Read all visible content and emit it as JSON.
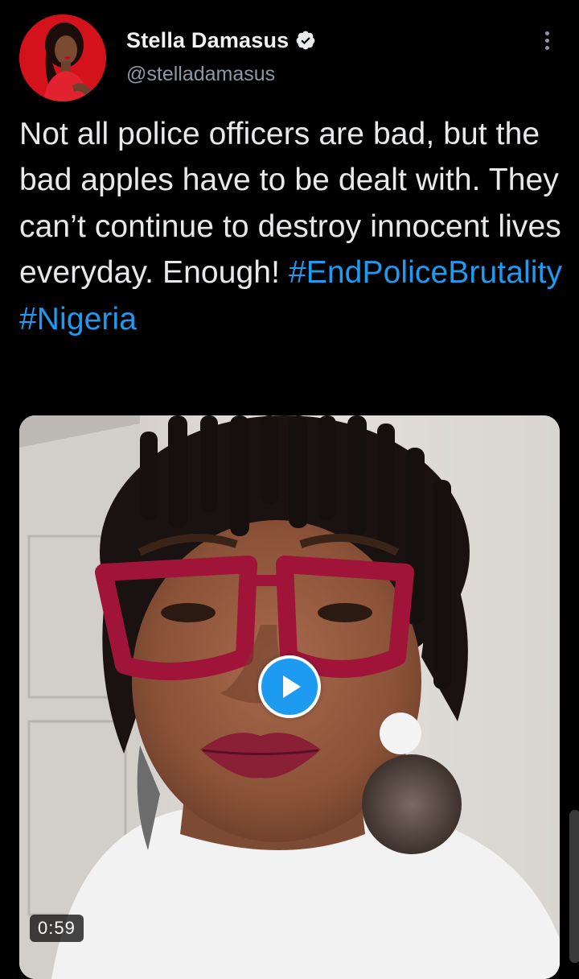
{
  "tweet": {
    "author": {
      "display_name": "Stella Damasus",
      "handle": "@stelladamasus",
      "verified": true,
      "verified_icon": "verified-badge-icon",
      "avatar_bg": "#d4121c"
    },
    "more_icon": "more-vertical-icon",
    "text_plain": "Not all police officers are bad, but the bad apples have to be dealt with. They can’t continue to destroy innocent lives everyday. Enough! ",
    "hashtags": [
      "#EndPoliceBrutality",
      "#Nigeria"
    ],
    "media": {
      "type": "video",
      "duration": "0:59",
      "play_icon": "play-icon"
    }
  },
  "colors": {
    "background": "#000000",
    "text": "#e7e9ea",
    "secondary_text": "#8b98a5",
    "link": "#1d9bf0",
    "accent": "#1d9bf0"
  }
}
